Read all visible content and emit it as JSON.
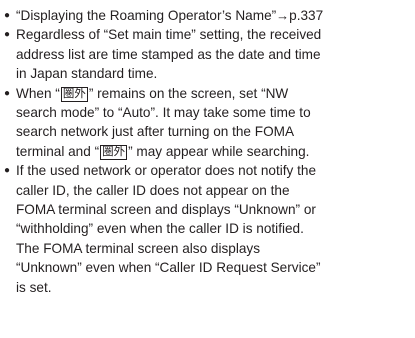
{
  "bullet_glyph": "●",
  "arrow_glyph": "→",
  "outside_area_icon_text": "圏外",
  "items": [
    {
      "lines": [
        "“Displaying the Roaming Operator’s Name”"
      ],
      "ref": "p.337"
    },
    {
      "lines": [
        "Regardless of “Set main time” setting, the received",
        "address list are time stamped as the date and time",
        "in Japan standard time."
      ]
    },
    {
      "line1_before": "When “",
      "line1_after": "” remains on the screen, set “NW",
      "lines_rest_a": [
        "search mode” to “Auto”. It may take some time to",
        "search network just after turning on the FOMA"
      ],
      "line4_before": "terminal and “",
      "line4_after": "” may appear while searching."
    },
    {
      "lines": [
        "If the used network or operator does not notify the",
        "caller ID, the caller ID does not appear on the",
        "FOMA terminal screen and displays “Unknown” or",
        "“withholding” even when the caller ID is notified.",
        "The FOMA terminal screen also displays",
        "“Unknown” even when “Caller ID Request Service”",
        "is set."
      ]
    }
  ]
}
